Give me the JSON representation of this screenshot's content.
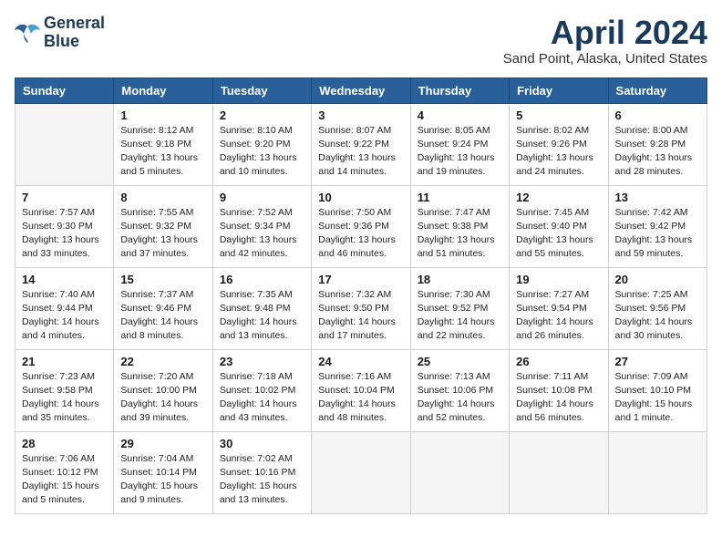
{
  "logo": {
    "line1": "General",
    "line2": "Blue"
  },
  "title": "April 2024",
  "subtitle": "Sand Point, Alaska, United States",
  "weekdays": [
    "Sunday",
    "Monday",
    "Tuesday",
    "Wednesday",
    "Thursday",
    "Friday",
    "Saturday"
  ],
  "weeks": [
    [
      {
        "day": "",
        "info": ""
      },
      {
        "day": "1",
        "info": "Sunrise: 8:12 AM\nSunset: 9:18 PM\nDaylight: 13 hours\nand 5 minutes."
      },
      {
        "day": "2",
        "info": "Sunrise: 8:10 AM\nSunset: 9:20 PM\nDaylight: 13 hours\nand 10 minutes."
      },
      {
        "day": "3",
        "info": "Sunrise: 8:07 AM\nSunset: 9:22 PM\nDaylight: 13 hours\nand 14 minutes."
      },
      {
        "day": "4",
        "info": "Sunrise: 8:05 AM\nSunset: 9:24 PM\nDaylight: 13 hours\nand 19 minutes."
      },
      {
        "day": "5",
        "info": "Sunrise: 8:02 AM\nSunset: 9:26 PM\nDaylight: 13 hours\nand 24 minutes."
      },
      {
        "day": "6",
        "info": "Sunrise: 8:00 AM\nSunset: 9:28 PM\nDaylight: 13 hours\nand 28 minutes."
      }
    ],
    [
      {
        "day": "7",
        "info": "Sunrise: 7:57 AM\nSunset: 9:30 PM\nDaylight: 13 hours\nand 33 minutes."
      },
      {
        "day": "8",
        "info": "Sunrise: 7:55 AM\nSunset: 9:32 PM\nDaylight: 13 hours\nand 37 minutes."
      },
      {
        "day": "9",
        "info": "Sunrise: 7:52 AM\nSunset: 9:34 PM\nDaylight: 13 hours\nand 42 minutes."
      },
      {
        "day": "10",
        "info": "Sunrise: 7:50 AM\nSunset: 9:36 PM\nDaylight: 13 hours\nand 46 minutes."
      },
      {
        "day": "11",
        "info": "Sunrise: 7:47 AM\nSunset: 9:38 PM\nDaylight: 13 hours\nand 51 minutes."
      },
      {
        "day": "12",
        "info": "Sunrise: 7:45 AM\nSunset: 9:40 PM\nDaylight: 13 hours\nand 55 minutes."
      },
      {
        "day": "13",
        "info": "Sunrise: 7:42 AM\nSunset: 9:42 PM\nDaylight: 13 hours\nand 59 minutes."
      }
    ],
    [
      {
        "day": "14",
        "info": "Sunrise: 7:40 AM\nSunset: 9:44 PM\nDaylight: 14 hours\nand 4 minutes."
      },
      {
        "day": "15",
        "info": "Sunrise: 7:37 AM\nSunset: 9:46 PM\nDaylight: 14 hours\nand 8 minutes."
      },
      {
        "day": "16",
        "info": "Sunrise: 7:35 AM\nSunset: 9:48 PM\nDaylight: 14 hours\nand 13 minutes."
      },
      {
        "day": "17",
        "info": "Sunrise: 7:32 AM\nSunset: 9:50 PM\nDaylight: 14 hours\nand 17 minutes."
      },
      {
        "day": "18",
        "info": "Sunrise: 7:30 AM\nSunset: 9:52 PM\nDaylight: 14 hours\nand 22 minutes."
      },
      {
        "day": "19",
        "info": "Sunrise: 7:27 AM\nSunset: 9:54 PM\nDaylight: 14 hours\nand 26 minutes."
      },
      {
        "day": "20",
        "info": "Sunrise: 7:25 AM\nSunset: 9:56 PM\nDaylight: 14 hours\nand 30 minutes."
      }
    ],
    [
      {
        "day": "21",
        "info": "Sunrise: 7:23 AM\nSunset: 9:58 PM\nDaylight: 14 hours\nand 35 minutes."
      },
      {
        "day": "22",
        "info": "Sunrise: 7:20 AM\nSunset: 10:00 PM\nDaylight: 14 hours\nand 39 minutes."
      },
      {
        "day": "23",
        "info": "Sunrise: 7:18 AM\nSunset: 10:02 PM\nDaylight: 14 hours\nand 43 minutes."
      },
      {
        "day": "24",
        "info": "Sunrise: 7:16 AM\nSunset: 10:04 PM\nDaylight: 14 hours\nand 48 minutes."
      },
      {
        "day": "25",
        "info": "Sunrise: 7:13 AM\nSunset: 10:06 PM\nDaylight: 14 hours\nand 52 minutes."
      },
      {
        "day": "26",
        "info": "Sunrise: 7:11 AM\nSunset: 10:08 PM\nDaylight: 14 hours\nand 56 minutes."
      },
      {
        "day": "27",
        "info": "Sunrise: 7:09 AM\nSunset: 10:10 PM\nDaylight: 15 hours\nand 1 minute."
      }
    ],
    [
      {
        "day": "28",
        "info": "Sunrise: 7:06 AM\nSunset: 10:12 PM\nDaylight: 15 hours\nand 5 minutes."
      },
      {
        "day": "29",
        "info": "Sunrise: 7:04 AM\nSunset: 10:14 PM\nDaylight: 15 hours\nand 9 minutes."
      },
      {
        "day": "30",
        "info": "Sunrise: 7:02 AM\nSunset: 10:16 PM\nDaylight: 15 hours\nand 13 minutes."
      },
      {
        "day": "",
        "info": ""
      },
      {
        "day": "",
        "info": ""
      },
      {
        "day": "",
        "info": ""
      },
      {
        "day": "",
        "info": ""
      }
    ]
  ]
}
